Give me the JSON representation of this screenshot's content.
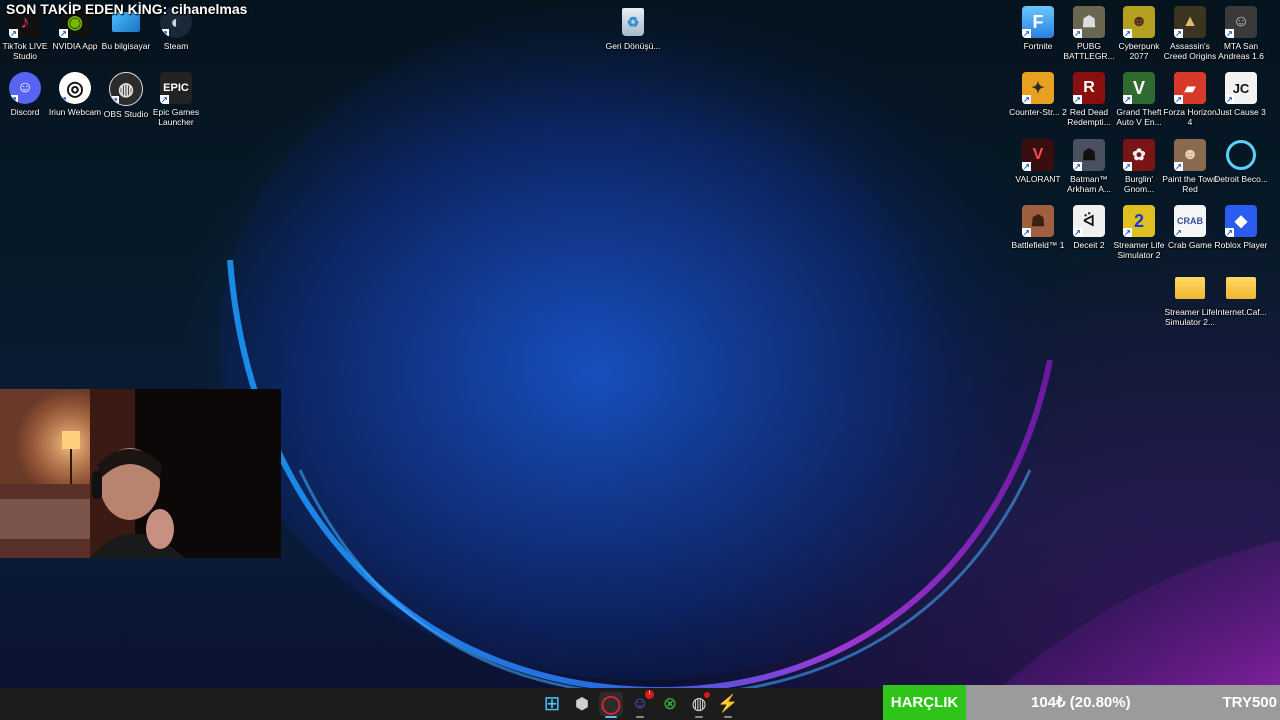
{
  "overlay": {
    "title": "SON TAKİP EDEN KİNG: cihanelmas"
  },
  "desktop_left": [
    {
      "label": "TikTok LIVE Studio",
      "icon": "tiktok-live-icon",
      "color": "#111111",
      "glyph": "♪"
    },
    {
      "label": "NVIDIA App",
      "icon": "nvidia-icon",
      "color": "#1a1a1a",
      "glyph": "◉"
    },
    {
      "label": "Bu bilgisayar",
      "icon": "computer-icon",
      "color": "#2a8fd9",
      "glyph": "▭"
    },
    {
      "label": "Steam",
      "icon": "steam-icon",
      "color": "#1b2838",
      "glyph": "◐"
    },
    {
      "label": "Discord",
      "icon": "discord-icon",
      "color": "#5865f2",
      "glyph": "☺"
    },
    {
      "label": "Iriun Webcam",
      "icon": "iriun-webcam-icon",
      "color": "#0d0d0d",
      "glyph": "◎"
    },
    {
      "label": "OBS Studio",
      "icon": "obs-icon",
      "color": "#2b2b2b",
      "glyph": "◍"
    },
    {
      "label": "Epic Games Launcher",
      "icon": "epic-games-icon",
      "color": "#222222",
      "glyph": "EPIC"
    }
  ],
  "recycle_bin": {
    "label": "Geri Dönüşü...",
    "icon": "recycle-bin-icon"
  },
  "desktop_right": [
    {
      "label": "Fortnite",
      "icon": "fortnite-icon",
      "color": "#3aa0f0",
      "glyph": "F"
    },
    {
      "label": "PUBG BATTLEGR...",
      "icon": "pubg-icon",
      "color": "#6b6650",
      "glyph": "☗"
    },
    {
      "label": "Cyberpunk 2077",
      "icon": "cyberpunk-icon",
      "color": "#b3a020",
      "glyph": "☻"
    },
    {
      "label": "Assassin's Creed Origins",
      "icon": "assassins-creed-icon",
      "color": "#3b3520",
      "glyph": "▲"
    },
    {
      "label": "MTA San Andreas 1.6",
      "icon": "mta-icon",
      "color": "#3a3a3a",
      "glyph": "☺"
    },
    {
      "label": "Counter-Str... 2",
      "icon": "counter-strike-icon",
      "color": "#e8a020",
      "glyph": "✦"
    },
    {
      "label": "Red Dead Redempti...",
      "icon": "red-dead-icon",
      "color": "#8a1010",
      "glyph": "R"
    },
    {
      "label": "Grand Theft Auto V En...",
      "icon": "gta-v-icon",
      "color": "#2f6a2f",
      "glyph": "V"
    },
    {
      "label": "Forza Horizon 4",
      "icon": "forza-icon",
      "color": "#d83a2a",
      "glyph": "▰"
    },
    {
      "label": "Just Cause 3",
      "icon": "just-cause-icon",
      "color": "#101820",
      "glyph": "JC"
    },
    {
      "label": "VALORANT",
      "icon": "valorant-icon",
      "color": "#3a0d10",
      "glyph": "V"
    },
    {
      "label": "Batman™ Arkham A...",
      "icon": "batman-icon",
      "color": "#4a5060",
      "glyph": "☗"
    },
    {
      "label": "Burglin' Gnom...",
      "icon": "burglin-gnomes-icon",
      "color": "#7a1515",
      "glyph": "✿"
    },
    {
      "label": "Paint the Town Red",
      "icon": "paint-the-town-red-icon",
      "color": "#8a6a50",
      "glyph": "☻"
    },
    {
      "label": "Detroit Beco...",
      "icon": "detroit-icon",
      "color": "#0a1a2a",
      "glyph": "◯"
    },
    {
      "label": "Battlefield™ 1",
      "icon": "battlefield-icon",
      "color": "#a06040",
      "glyph": "☗"
    },
    {
      "label": "Deceit 2",
      "icon": "deceit-icon",
      "color": "#f0f0f0",
      "glyph": "🐇"
    },
    {
      "label": "Streamer Life Simulator 2",
      "icon": "streamer-life-icon",
      "color": "#e0c020",
      "glyph": "2"
    },
    {
      "label": "Crab Game",
      "icon": "crab-game-icon",
      "color": "#f5f5f5",
      "glyph": "CRAB"
    },
    {
      "label": "Roblox Player",
      "icon": "roblox-icon",
      "color": "#2a5cf0",
      "glyph": "◆"
    },
    {
      "label": "Streamer Life Simulator 2...",
      "icon": "folder-icon",
      "color": "#f0c040",
      "glyph": ""
    },
    {
      "label": "Internet.Caf...",
      "icon": "folder-icon",
      "color": "#f0c040",
      "glyph": ""
    }
  ],
  "taskbar": {
    "buttons": [
      {
        "name": "start-icon",
        "glyph": "⊞",
        "color": "#4cc2ff"
      },
      {
        "name": "app-icon",
        "glyph": "⬢",
        "color": "#cfcfcf"
      },
      {
        "name": "opera-gx-icon",
        "glyph": "◯",
        "color": "#e0252a"
      },
      {
        "name": "discord-icon",
        "glyph": "☺",
        "color": "#5865f2"
      },
      {
        "name": "xbox-icon",
        "glyph": "⊗",
        "color": "#3fb43f"
      },
      {
        "name": "obs-icon",
        "glyph": "◍",
        "color": "#dddddd"
      },
      {
        "name": "streamer-life-icon",
        "glyph": "⚡",
        "color": "#e0c020"
      }
    ]
  },
  "ticker": {
    "tag": "HARÇLIK",
    "change": "104₺ (20.80%)",
    "price": "TRY500"
  }
}
